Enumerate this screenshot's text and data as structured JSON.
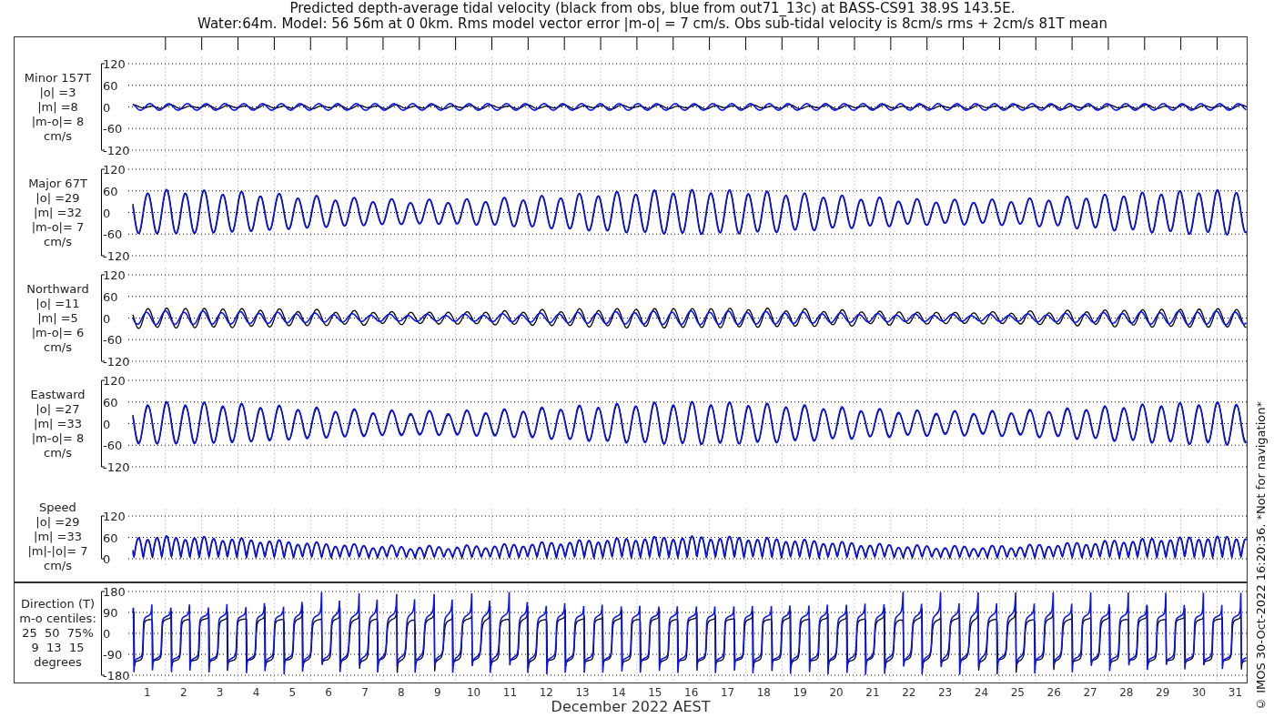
{
  "title": [
    "Predicted depth-average tidal velocity (black from obs, blue from out71_13c) at BASS-CS91 38.9S 143.5E.",
    "Water:64m. Model: 56 56m at 0 0km. Rms model vector error |m-o| = 7 cm/s. Obs sub-tidal velocity is 8cm/s rms + 2cm/s 81T mean"
  ],
  "panels": [
    {
      "kind": "velocity",
      "labels": [
        "Minor 157T",
        "|o| =3",
        "|m| =8",
        "|m-o|= 8",
        "cm/s"
      ],
      "yticks": [
        "120",
        "60",
        "0",
        "-60",
        "-120"
      ]
    },
    {
      "kind": "velocity",
      "labels": [
        "Major 67T",
        "|o| =29",
        "|m| =32",
        "|m-o|= 7",
        "cm/s"
      ],
      "yticks": [
        "120",
        "60",
        "0",
        "-60",
        "-120"
      ]
    },
    {
      "kind": "velocity",
      "labels": [
        "Northward",
        "|o| =11",
        "|m| =5",
        "|m-o|= 6",
        "cm/s"
      ],
      "yticks": [
        "120",
        "60",
        "0",
        "-60",
        "-120"
      ]
    },
    {
      "kind": "velocity",
      "labels": [
        "Eastward",
        "|o| =27",
        "|m| =33",
        "|m-o|= 8",
        "cm/s"
      ],
      "yticks": [
        "120",
        "60",
        "0",
        "-60",
        "-120"
      ]
    },
    {
      "kind": "speed",
      "labels": [
        "Speed",
        "|o| =29",
        "|m| =33",
        "|m|-|o|= 7",
        "cm/s"
      ],
      "yticks": [
        "120",
        "60",
        "0"
      ]
    },
    {
      "kind": "direction",
      "labels": [
        "Direction (T)",
        "m-o centiles:",
        "25  50  75%",
        "9  13  15",
        "degrees"
      ],
      "yticks": [
        "180",
        "90",
        "0",
        "-90",
        "-180"
      ]
    }
  ],
  "xaxis": {
    "ticks": [
      "1",
      "2",
      "3",
      "4",
      "5",
      "6",
      "7",
      "8",
      "9",
      "10",
      "11",
      "12",
      "13",
      "14",
      "15",
      "16",
      "17",
      "18",
      "19",
      "20",
      "21",
      "22",
      "23",
      "24",
      "25",
      "26",
      "27",
      "28",
      "29",
      "30",
      "31"
    ],
    "label": "December 2022 AEST"
  },
  "footer_note": "© IMOS 30-Oct-2022 16:20:36. *Not for navigation*"
}
